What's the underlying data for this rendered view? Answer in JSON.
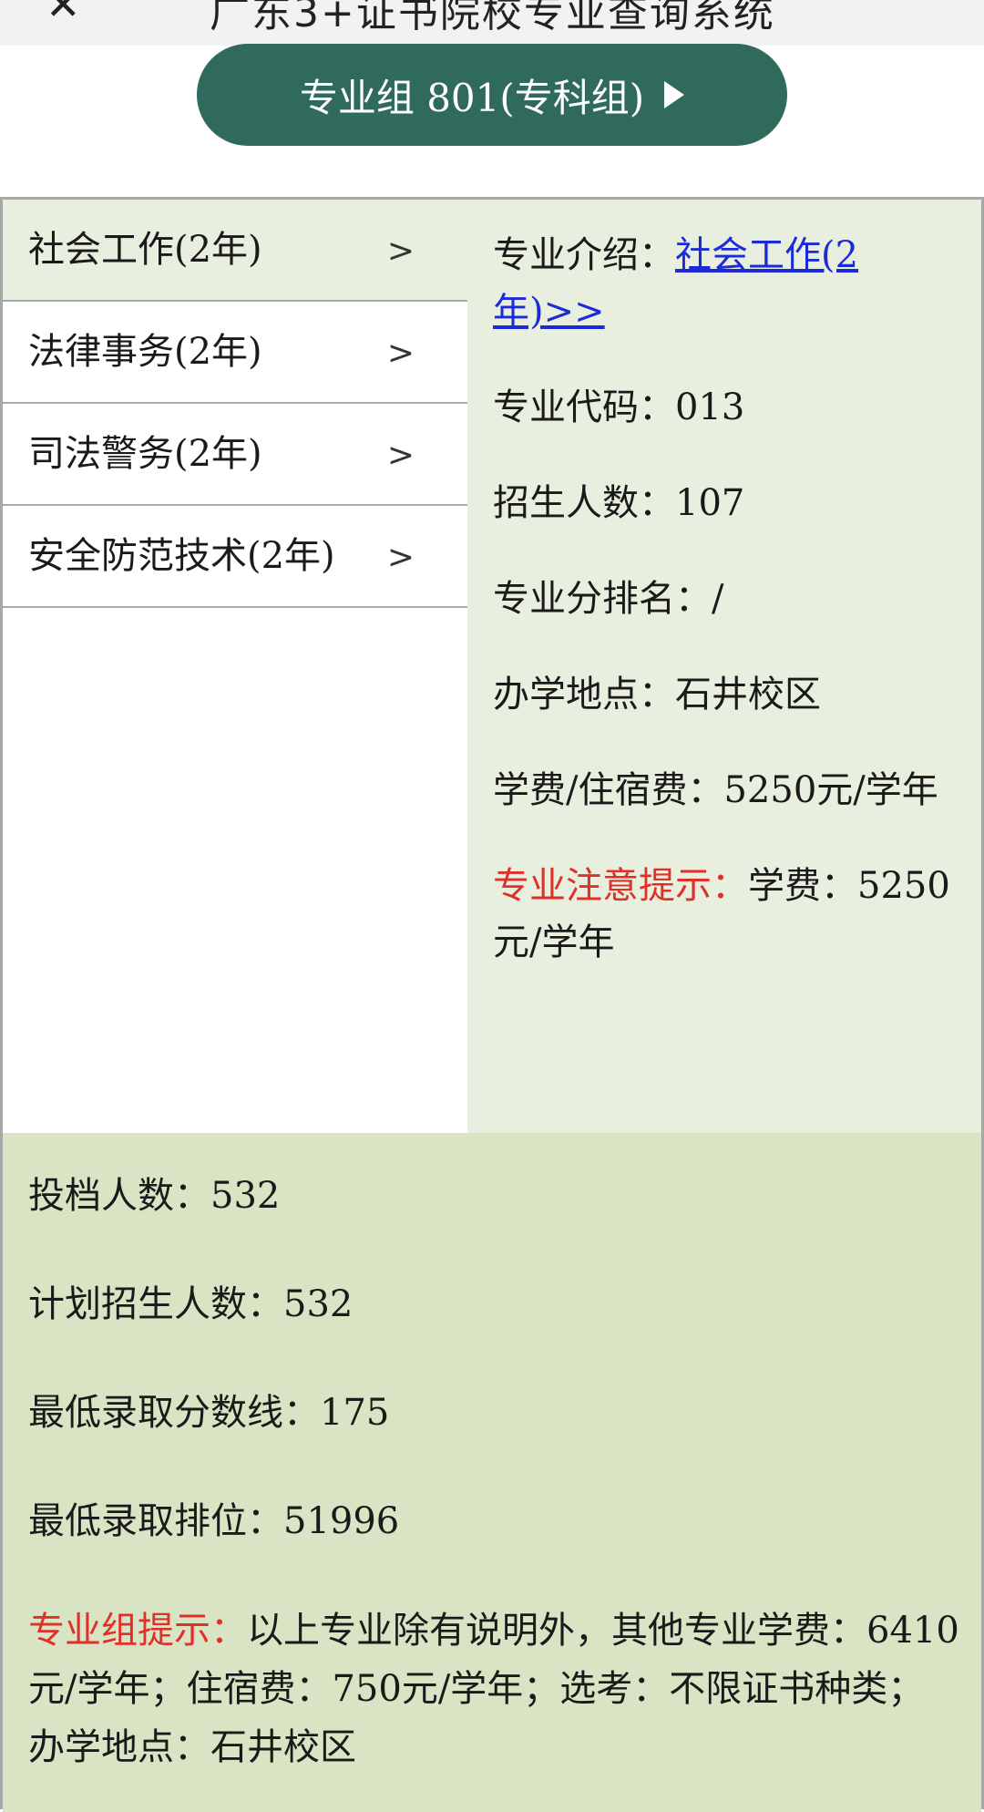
{
  "header": {
    "back_icon": "close-icon",
    "title": "广东3+证书院校专业查询系统"
  },
  "group_button": {
    "label": "专业组 801(专科组)",
    "icon": "play-icon"
  },
  "majors": [
    {
      "name": "社会工作(2年)",
      "selected": true
    },
    {
      "name": "法律事务(2年)",
      "selected": false
    },
    {
      "name": "司法警务(2年)",
      "selected": false
    },
    {
      "name": "安全防范技术(2年)",
      "selected": false
    }
  ],
  "detail": {
    "intro_label": "专业介绍：",
    "intro_link": "社会工作(2年)>>",
    "code_label": "专业代码：",
    "code_value": "013",
    "enroll_label": "招生人数：",
    "enroll_value": "107",
    "rank_label": "专业分排名：",
    "rank_value": "/",
    "location_label": "办学地点：",
    "location_value": "石井校区",
    "fee_label": "学费/住宿费：",
    "fee_value": "5250元/学年",
    "notice_label": "专业注意提示：",
    "notice_value": "学费：5250元/学年"
  },
  "group_stats": {
    "filed_label": "投档人数：",
    "filed_value": "532",
    "plan_label": "计划招生人数：",
    "plan_value": "532",
    "min_score_label": "最低录取分数线：",
    "min_score_value": "175",
    "min_rank_label": "最低录取排位：",
    "min_rank_value": "51996",
    "note_label": "专业组提示：",
    "note_value": "以上专业除有说明外，其他专业学费：6410元/学年；住宿费：750元/学年；选考：不限证书种类；办学地点：石井校区"
  },
  "colors": {
    "button_bg": "#2f6a5d",
    "detail_bg": "#e8efdf",
    "stats_bg": "#d9e4c4",
    "link": "#1d2bd6",
    "alert": "#e0302a"
  }
}
